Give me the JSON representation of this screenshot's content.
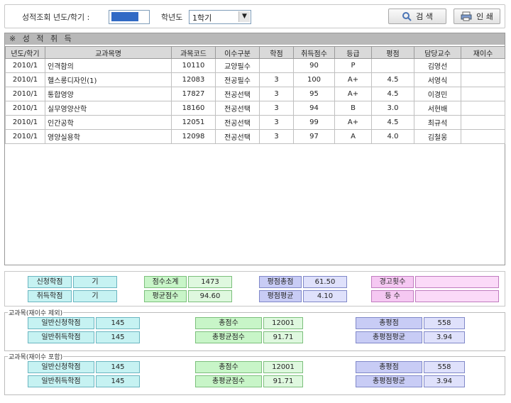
{
  "search": {
    "year_semester_label": "성적조회 년도/학기 :",
    "year_value": "",
    "semester_label": "학년도",
    "semester_value": "1학기",
    "search_button": "검 색",
    "print_button": "인 쇄"
  },
  "grid": {
    "title": "※ 성 적 취 득",
    "columns": [
      "년도/학기",
      "교과목명",
      "과목코드",
      "이수구분",
      "학점",
      "취득점수",
      "등급",
      "평점",
      "담당교수",
      "재이수"
    ],
    "rows": [
      [
        "2010/1",
        "인격함의",
        "10110",
        "교양필수",
        "",
        "90",
        "P",
        "",
        "김영선",
        ""
      ],
      [
        "2010/1",
        "헬스롱디자인(1)",
        "12083",
        "전공필수",
        "3",
        "100",
        "A+",
        "4.5",
        "서영식",
        ""
      ],
      [
        "2010/1",
        "통합영양",
        "17827",
        "전공선택",
        "3",
        "95",
        "A+",
        "4.5",
        "이경민",
        ""
      ],
      [
        "2010/1",
        "실무영양산학",
        "18160",
        "전공선택",
        "3",
        "94",
        "B",
        "3.0",
        "서현배",
        ""
      ],
      [
        "2010/1",
        "인간공학",
        "12051",
        "전공선택",
        "3",
        "99",
        "A+",
        "4.5",
        "최규석",
        ""
      ],
      [
        "2010/1",
        "영양실용학",
        "12098",
        "전공선택",
        "3",
        "97",
        "A",
        "4.0",
        "김철웅",
        ""
      ]
    ]
  },
  "summary": {
    "applied_label": "신청학점",
    "applied_value": "기",
    "earned_label": "취득학점",
    "earned_value": "기",
    "sum_label": "점수소계",
    "sum_value": "1473",
    "avg_label": "평균점수",
    "avg_value": "94.60",
    "grade_total_label": "평점총점",
    "grade_total_value": "61.50",
    "grade_avg_label": "평점평균",
    "grade_avg_value": "4.10",
    "warning_label": "경고횟수",
    "warning_value": "",
    "rank_label": "등 수",
    "rank_value": ""
  },
  "group1": {
    "legend": "교과목(재이수 제외)",
    "r1_label": "일반신청학점",
    "r1_value": "145",
    "r2_label": "일반취득학점",
    "r2_value": "145",
    "g1_label": "총점수",
    "g1_value": "12001",
    "g2_label": "총평균점수",
    "g2_value": "91.71",
    "b1_label": "총평점",
    "b1_value": "558",
    "b2_label": "총평점평균",
    "b2_value": "3.94"
  },
  "group2": {
    "legend": "교과목(재이수 포함)",
    "r1_label": "일반신청학점",
    "r1_value": "145",
    "r2_label": "일반취득학점",
    "r2_value": "145",
    "g1_label": "총점수",
    "g1_value": "12001",
    "g2_label": "총평균점수",
    "g2_value": "91.71",
    "b1_label": "총평점",
    "b1_value": "558",
    "b2_label": "총평점평균",
    "b2_value": "3.94"
  },
  "icons": {
    "search": "magnifier-icon",
    "print": "printer-icon"
  }
}
